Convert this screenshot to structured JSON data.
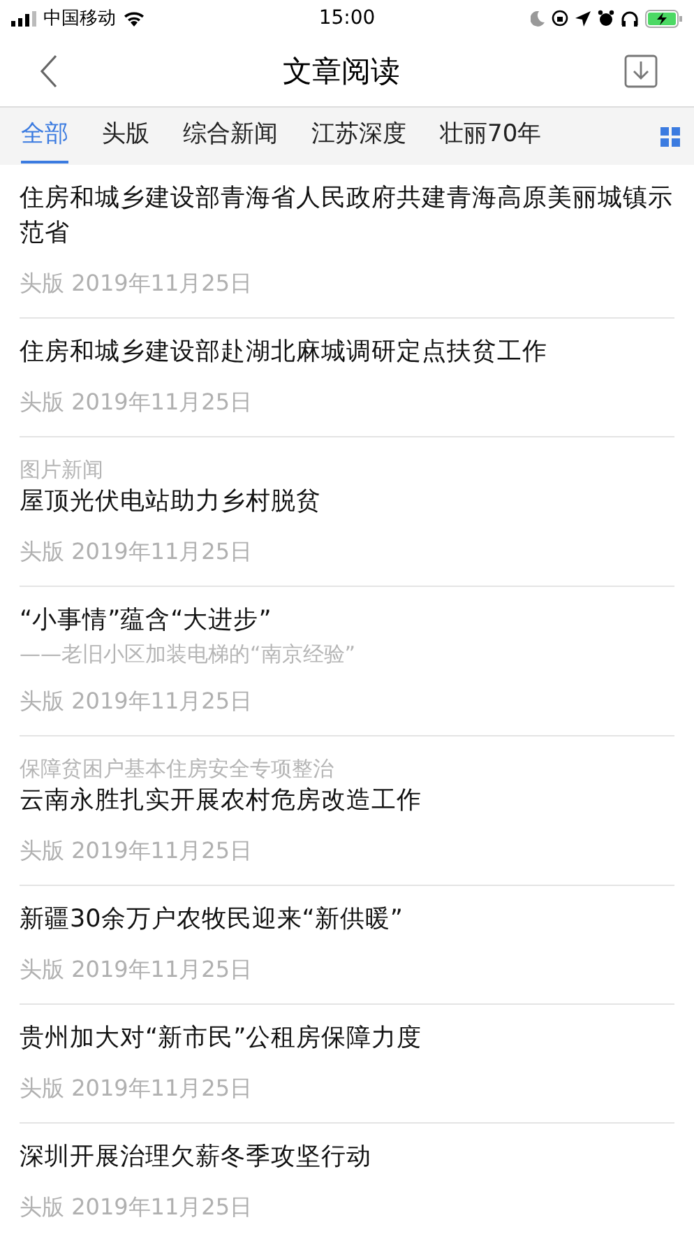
{
  "status_bar": {
    "carrier": "中国移动",
    "time": "15:00"
  },
  "nav": {
    "title": "文章阅读"
  },
  "tabs": [
    {
      "label": "全部",
      "selected": true
    },
    {
      "label": "头版",
      "selected": false
    },
    {
      "label": "综合新闻",
      "selected": false
    },
    {
      "label": "江苏深度",
      "selected": false
    },
    {
      "label": "壮丽70年",
      "selected": false
    }
  ],
  "articles": [
    {
      "title": "住房和城乡建设部青海省人民政府共建青海高原美丽城镇示范省",
      "meta": "头版 2019年11月25日"
    },
    {
      "title": "住房和城乡建设部赴湖北麻城调研定点扶贫工作",
      "meta": "头版 2019年11月25日"
    },
    {
      "pretitle": "图片新闻",
      "title": "屋顶光伏电站助力乡村脱贫",
      "meta": "头版 2019年11月25日"
    },
    {
      "title": "“小事情”蕴含“大进步”",
      "subtitle": "——老旧小区加装电梯的“南京经验”",
      "meta": "头版 2019年11月25日"
    },
    {
      "pretitle": "保障贫困户基本住房安全专项整治",
      "title": "云南永胜扎实开展农村危房改造工作",
      "meta": "头版 2019年11月25日"
    },
    {
      "title": "新疆30余万户农牧民迎来“新供暖”",
      "meta": "头版 2019年11月25日"
    },
    {
      "title": "贵州加大对“新市民”公租房保障力度",
      "meta": "头版 2019年11月25日"
    },
    {
      "title": "深圳开展治理欠薪冬季攻坚行动",
      "meta": "头版 2019年11月25日"
    }
  ]
}
